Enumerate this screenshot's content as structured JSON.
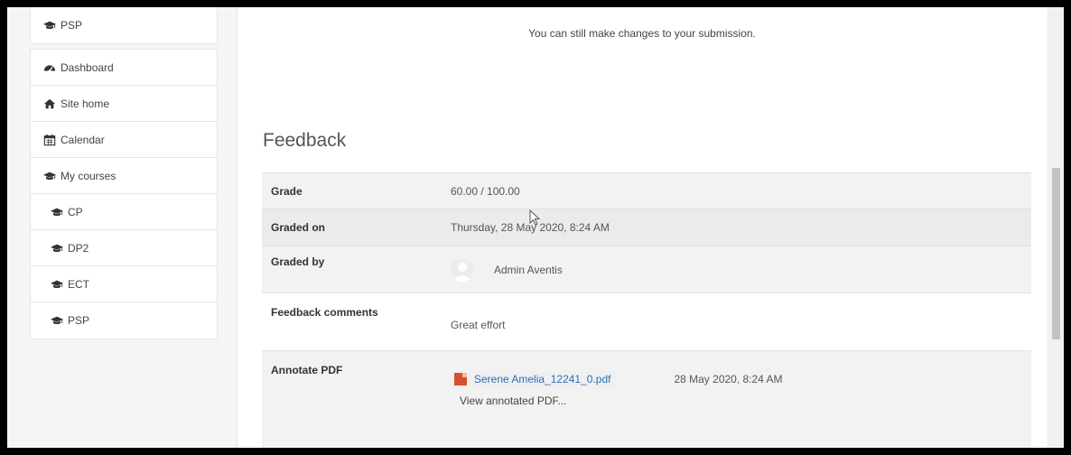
{
  "sidebar": {
    "top_item": {
      "label": "PSP",
      "icon": "graduation-cap-icon"
    },
    "items": [
      {
        "label": "Dashboard",
        "icon": "dashboard-icon"
      },
      {
        "label": "Site home",
        "icon": "home-icon"
      },
      {
        "label": "Calendar",
        "icon": "calendar-icon"
      },
      {
        "label": "My courses",
        "icon": "graduation-cap-icon"
      },
      {
        "label": "CP",
        "icon": "graduation-cap-icon"
      },
      {
        "label": "DP2",
        "icon": "graduation-cap-icon"
      },
      {
        "label": "ECT",
        "icon": "graduation-cap-icon"
      },
      {
        "label": "PSP",
        "icon": "graduation-cap-icon"
      }
    ]
  },
  "main": {
    "status_message": "You can still make changes to your submission.",
    "feedback_title": "Feedback",
    "rows": {
      "grade": {
        "label": "Grade",
        "value": "60.00 / 100.00"
      },
      "graded_on": {
        "label": "Graded on",
        "value": "Thursday, 28 May 2020, 8:24 AM"
      },
      "graded_by": {
        "label": "Graded by",
        "value": "Admin Aventis"
      },
      "feedback_comments": {
        "label": "Feedback comments",
        "value": "Great effort"
      },
      "annotate_pdf": {
        "label": "Annotate PDF",
        "file_name": "Serene Amelia_12241_0.pdf",
        "file_date": "28 May 2020, 8:24 AM",
        "view_link": "View annotated PDF..."
      }
    }
  },
  "colors": {
    "link": "#2b6fb3",
    "pdf_icon": "#d9502f",
    "row_shade": "#f2f2f2"
  }
}
